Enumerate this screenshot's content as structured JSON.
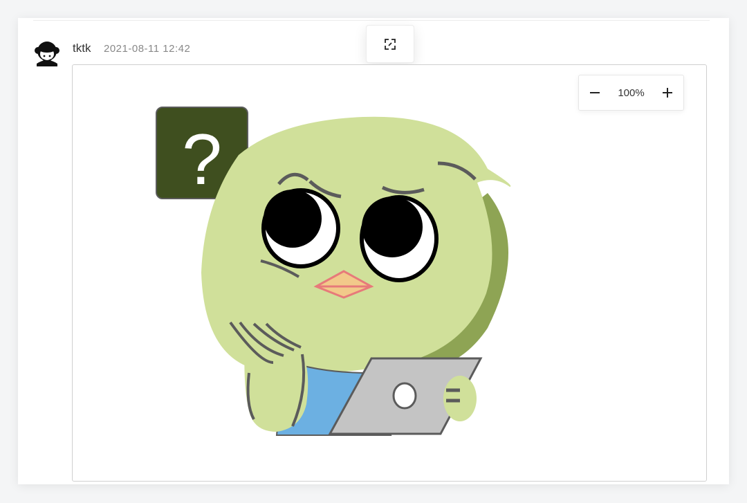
{
  "post": {
    "username": "tktk",
    "timestamp": "2021-08-11 12:42"
  },
  "toolbar": {
    "expand_icon": "expand-icon"
  },
  "viewer": {
    "zoom_level": "100%",
    "zoom_out_icon": "minus-icon",
    "zoom_in_icon": "plus-icon"
  },
  "sticker": {
    "question_mark": "?",
    "colors": {
      "body": "#d0e09a",
      "body_shadow": "#8ea454",
      "sign": "#3f4f1f",
      "laptop": "#c4c4c4",
      "shirt": "#6cb0e2",
      "beak": "#f2c98a",
      "beak_outline": "#e77a7a"
    }
  }
}
